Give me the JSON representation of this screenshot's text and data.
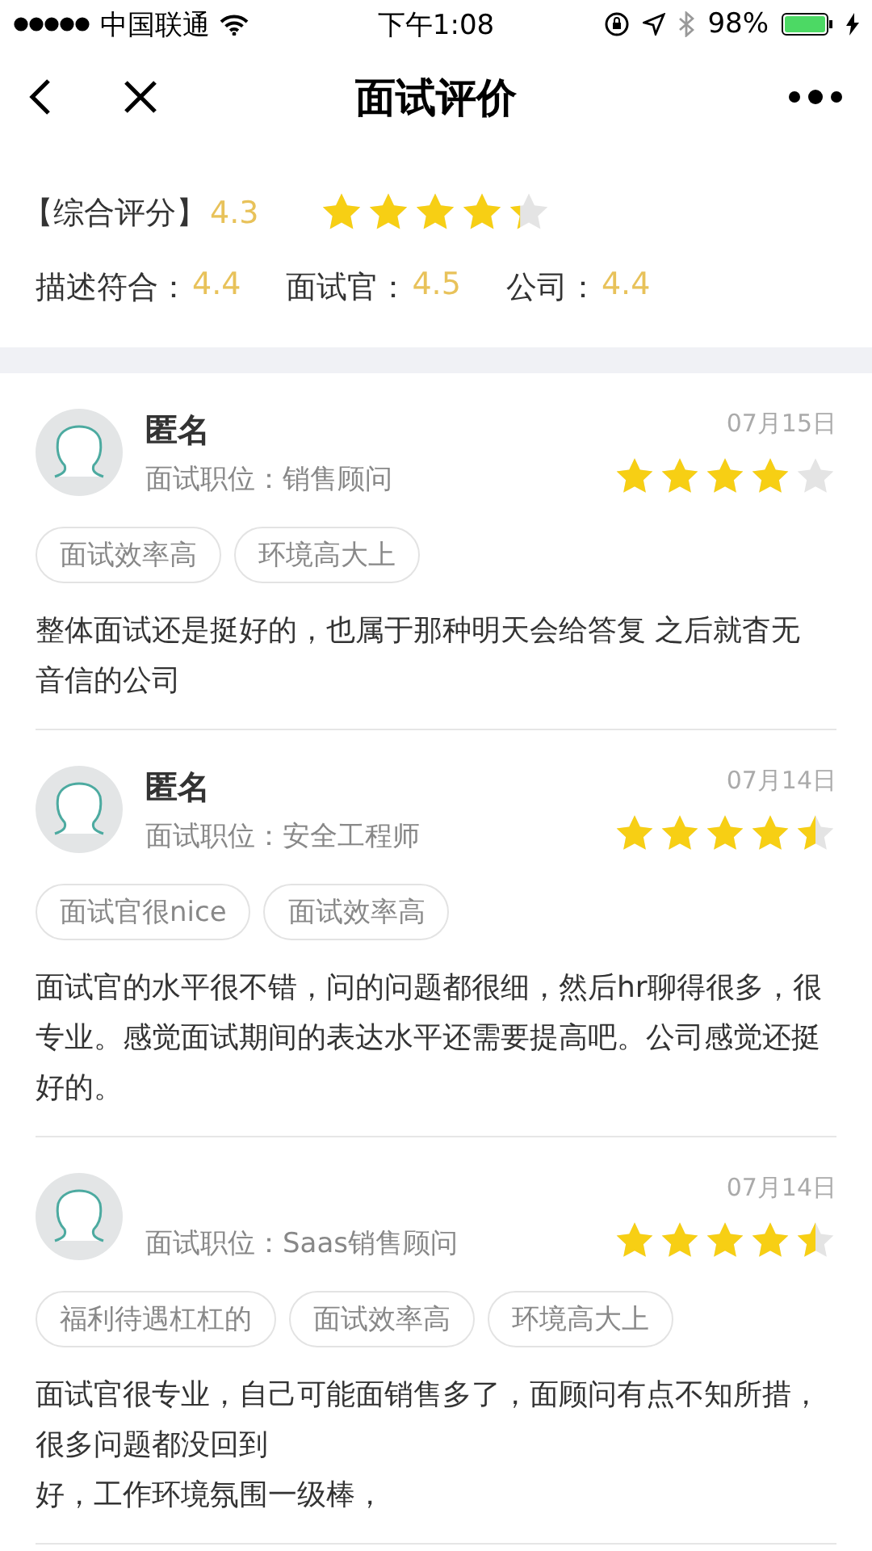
{
  "status_bar": {
    "carrier": "中国联通",
    "time": "下午1:08",
    "battery": "98%"
  },
  "nav": {
    "title": "面试评价"
  },
  "summary": {
    "overall_label": "【综合评分】",
    "overall_score": "4.3",
    "stars": 4.3,
    "scores": [
      {
        "label": "描述符合：",
        "value": "4.4"
      },
      {
        "label": "面试官：",
        "value": "4.5"
      },
      {
        "label": "公司：",
        "value": "4.4"
      }
    ]
  },
  "reviews": [
    {
      "name": "匿名",
      "position": "面试职位：销售顾问",
      "date": "07月15日",
      "stars": 4,
      "tags": [
        "面试效率高",
        "环境高大上"
      ],
      "body": "整体面试还是挺好的，也属于那种明天会给答复 之后就杳无音信的公司"
    },
    {
      "name": "匿名",
      "position": "面试职位：安全工程师",
      "date": "07月14日",
      "stars": 4.5,
      "tags": [
        "面试官很nice",
        "面试效率高"
      ],
      "body": "面试官的水平很不错，问的问题都很细，然后hr聊得很多，很专业。感觉面试期间的表达水平还需要提高吧。公司感觉还挺好的。"
    },
    {
      "position": "面试职位：Saas销售顾问",
      "date": "07月14日",
      "stars": 4.5,
      "tags": [
        "福利待遇杠杠的",
        "面试效率高",
        "环境高大上"
      ],
      "body": "面试官很专业，自己可能面销售多了，面顾问有点不知所措，很多问题都没回到",
      "body_tail": "好，工作环境氛围一级棒，"
    }
  ]
}
